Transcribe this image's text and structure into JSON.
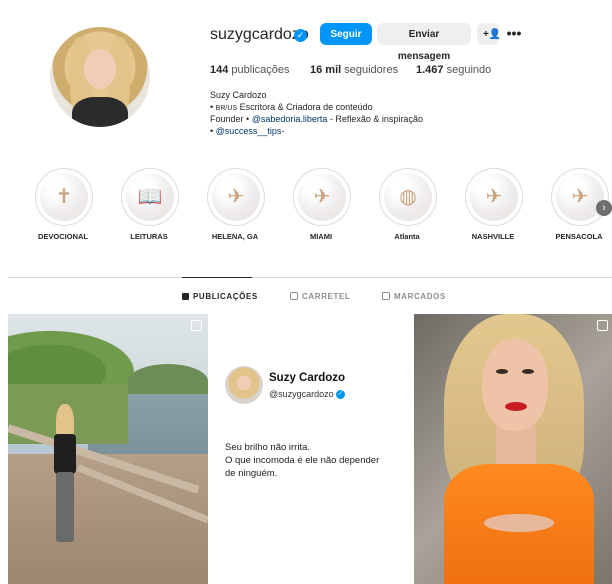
{
  "profile": {
    "username": "suzygcardozo",
    "follow_label": "Seguir",
    "message_label": "Enviar mensagem",
    "add_user_icon": "add-user-icon",
    "more_label": "•••",
    "stats": {
      "posts_count": "144",
      "posts_label": "publicações",
      "followers_count": "16 mil",
      "followers_label": "seguidores",
      "following_count": "1.467",
      "following_label": "seguindo"
    },
    "bio": {
      "name": "Suzy Cardozo",
      "line1_flag": "BR/US",
      "line1_text": "Escritora & Criadora de conteúdo",
      "line2_prefix": "Founder •",
      "line2_link": "@sabedoria.liberta",
      "line2_suffix": "- Reflexão & inspiração",
      "line3_prefix": "•",
      "line3_link": "@success__tips",
      "line3_suffix": "-"
    }
  },
  "highlights": [
    {
      "label": "DEVOCIONAL",
      "icon": "cross-icon",
      "glyph": "✝"
    },
    {
      "label": "LEITURAS",
      "icon": "book-icon",
      "glyph": "📖"
    },
    {
      "label": "HELENA, GA",
      "icon": "airplane-icon",
      "glyph": "✈"
    },
    {
      "label": "MIAMI",
      "icon": "airplane-icon",
      "glyph": "✈"
    },
    {
      "label": "Atlanta",
      "icon": "globe-icon",
      "glyph": "◍"
    },
    {
      "label": "NASHVILLE",
      "icon": "airplane-icon",
      "glyph": "✈"
    },
    {
      "label": "PENSACOLA",
      "icon": "airplane-icon",
      "glyph": "✈"
    }
  ],
  "tabs": [
    {
      "label": "PUBLICAÇÕES",
      "active": true
    },
    {
      "label": "CARRETEL",
      "active": false
    },
    {
      "label": "MARCADOS",
      "active": false
    }
  ],
  "post2": {
    "name": "Suzy Cardozo",
    "handle": "@suzygcardozo",
    "line1": "Seu brilho não irrita.",
    "line2": "O que incomoda é ele não depender",
    "line3": "de ninguém."
  },
  "colors": {
    "accent": "#0095f6",
    "link": "#00376b",
    "text": "#262626",
    "muted": "#8e8e8e"
  }
}
